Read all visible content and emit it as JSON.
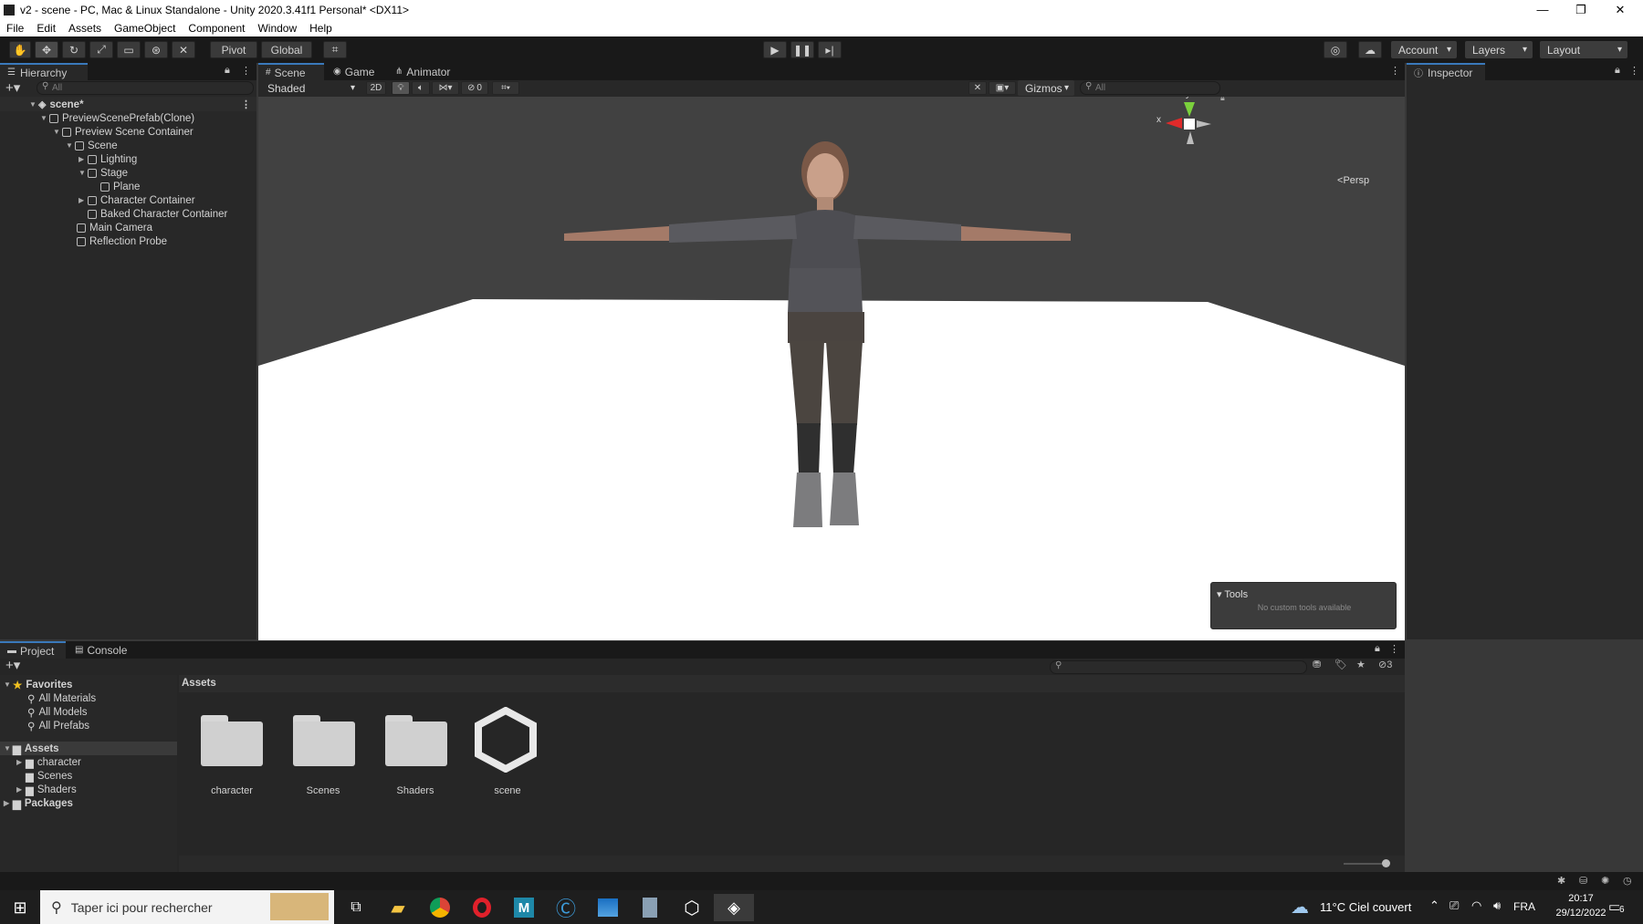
{
  "window": {
    "title": "v2 - scene - PC, Mac & Linux Standalone - Unity 2020.3.41f1 Personal* <DX11>",
    "controls": [
      "—",
      "❐",
      "✕"
    ]
  },
  "menu": [
    "File",
    "Edit",
    "Assets",
    "GameObject",
    "Component",
    "Window",
    "Help"
  ],
  "toolbar": {
    "pivot": "Pivot",
    "global": "Global",
    "account": "Account",
    "layers": "Layers",
    "layout": "Layout"
  },
  "hierarchy": {
    "tab": "Hierarchy",
    "search_placeholder": "All",
    "items": [
      {
        "label": "scene*",
        "depth": 0
      },
      {
        "label": "PreviewScenePrefab(Clone)",
        "depth": 1
      },
      {
        "label": "Preview Scene Container",
        "depth": 2
      },
      {
        "label": "Scene",
        "depth": 3
      },
      {
        "label": "Lighting",
        "depth": 4
      },
      {
        "label": "Stage",
        "depth": 4
      },
      {
        "label": "Plane",
        "depth": 5
      },
      {
        "label": "Character Container",
        "depth": 4
      },
      {
        "label": "Baked Character Container",
        "depth": 4
      },
      {
        "label": "Main Camera",
        "depth": 3
      },
      {
        "label": "Reflection Probe",
        "depth": 3
      }
    ]
  },
  "scene_tabs": [
    "Scene",
    "Game",
    "Animator"
  ],
  "scene_toolbar": {
    "shading": "Shaded",
    "mode_2d": "2D",
    "hidden_count": "0",
    "gizmos": "Gizmos",
    "search_placeholder": "All"
  },
  "gizmo": {
    "y": "y",
    "x": "x",
    "persp": "Persp"
  },
  "tools_overlay": {
    "title": "Tools",
    "message": "No custom tools available"
  },
  "inspector": {
    "tab": "Inspector"
  },
  "project": {
    "tabs": [
      "Project",
      "Console"
    ],
    "hidden_count": "3",
    "breadcrumb": "Assets",
    "favorites": {
      "label": "Favorites",
      "items": [
        "All Materials",
        "All Models",
        "All Prefabs"
      ]
    },
    "assets": {
      "label": "Assets",
      "items": [
        "character",
        "Scenes",
        "Shaders"
      ]
    },
    "packages": "Packages",
    "grid": [
      "character",
      "Scenes",
      "Shaders",
      "scene"
    ]
  },
  "taskbar": {
    "search_placeholder": "Taper ici pour rechercher",
    "weather": "11°C  Ciel couvert",
    "lang": "FRA",
    "time": "20:17",
    "date": "29/12/2022",
    "notif_count": "6"
  },
  "colors": {
    "accent": "#3a79bb",
    "editor_bg": "#282828",
    "toolbar_bg": "#191919"
  }
}
